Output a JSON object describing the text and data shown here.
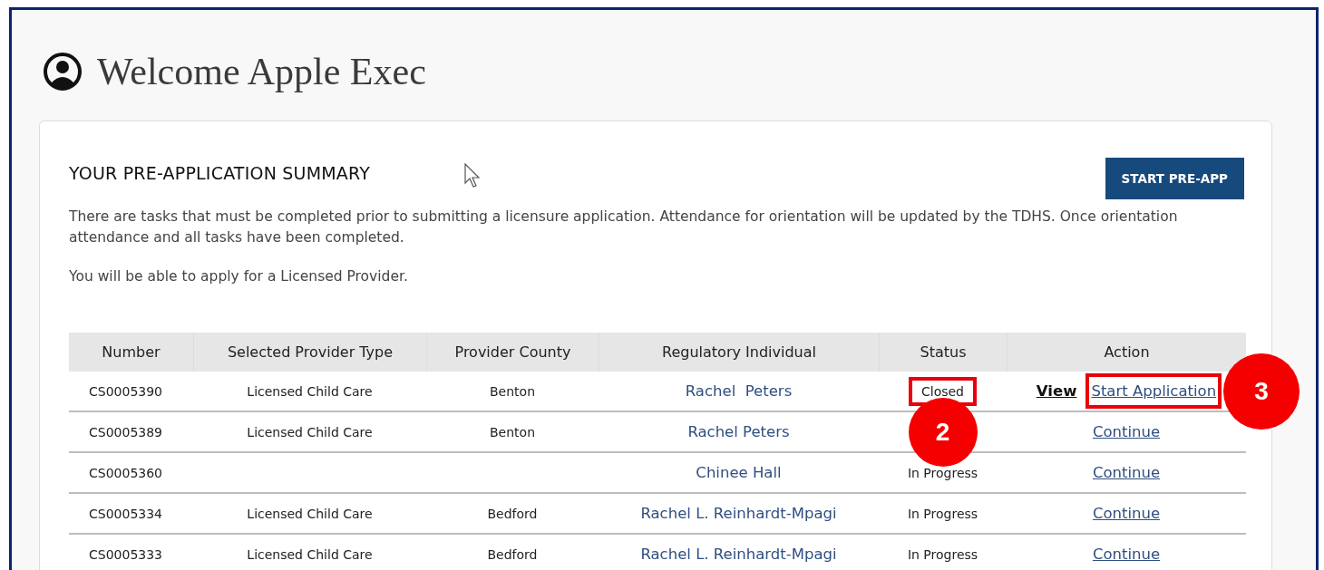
{
  "page": {
    "title": "Welcome Apple Exec"
  },
  "summary": {
    "heading": "YOUR PRE-APPLICATION SUMMARY",
    "button": "START PRE-APP",
    "paragraphs": [
      "There are tasks that must be completed prior to submitting a licensure application. Attendance for orientation will be updated by the TDHS. Once orientation attendance and all tasks have been completed.",
      "You will be able to apply for a Licensed Provider."
    ]
  },
  "table": {
    "columns": [
      "Number",
      "Selected Provider Type",
      "Provider County",
      "Regulatory Individual",
      "Status",
      "Action"
    ],
    "rows": [
      {
        "number": "CS0005390",
        "provider_type": "Licensed Child Care",
        "county": "Benton",
        "individual": "Rachel  Peters",
        "status": {
          "text": "Closed",
          "highlighted": true,
          "callout": "2"
        },
        "actions": [
          {
            "label": "View",
            "kind": "plain",
            "highlighted": false
          },
          {
            "label": "Start Application",
            "kind": "link",
            "highlighted": true,
            "callout": "3"
          }
        ]
      },
      {
        "number": "CS0005389",
        "provider_type": "Licensed Child Care",
        "county": "Benton",
        "individual": "Rachel Peters",
        "actions": [
          {
            "label": "Continue",
            "kind": "link",
            "highlighted": false
          }
        ]
      },
      {
        "number": "CS0005360",
        "individual": "Chinee Hall",
        "status": {
          "text": "In Progress",
          "highlighted": false
        },
        "actions": [
          {
            "label": "Continue",
            "kind": "link",
            "highlighted": false
          }
        ]
      },
      {
        "number": "CS0005334",
        "provider_type": "Licensed Child Care",
        "county": "Bedford",
        "individual": "Rachel L. Reinhardt-Mpagi",
        "status": {
          "text": "In Progress",
          "highlighted": false
        },
        "actions": [
          {
            "label": "Continue",
            "kind": "link",
            "highlighted": false
          }
        ]
      },
      {
        "number": "CS0005333",
        "provider_type": "Licensed Child Care",
        "county": "Bedford",
        "individual": "Rachel L. Reinhardt-Mpagi",
        "status": {
          "text": "In Progress",
          "highlighted": false
        },
        "actions": [
          {
            "label": "Continue",
            "kind": "link",
            "highlighted": false
          }
        ]
      }
    ]
  }
}
